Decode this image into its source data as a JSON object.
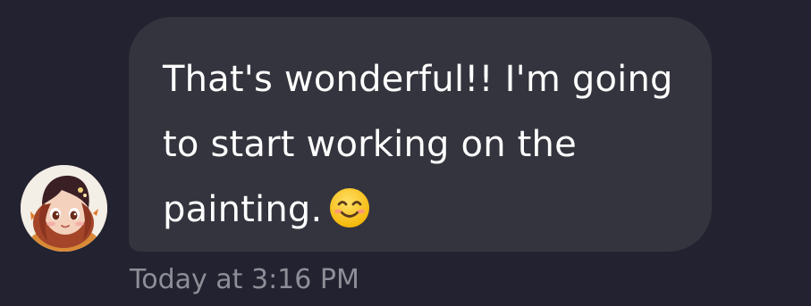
{
  "message": {
    "text": "That's wonderful!! I'm going to start working on the painting.",
    "emoji": "smiling-face-with-smiling-eyes",
    "timestamp": "Today at 3:16 PM"
  },
  "colors": {
    "background": "#222230",
    "bubble": "#34343e",
    "text": "#ffffff",
    "timestamp": "#8e8e98"
  },
  "avatar": {
    "icon": "user-avatar-illustration"
  }
}
